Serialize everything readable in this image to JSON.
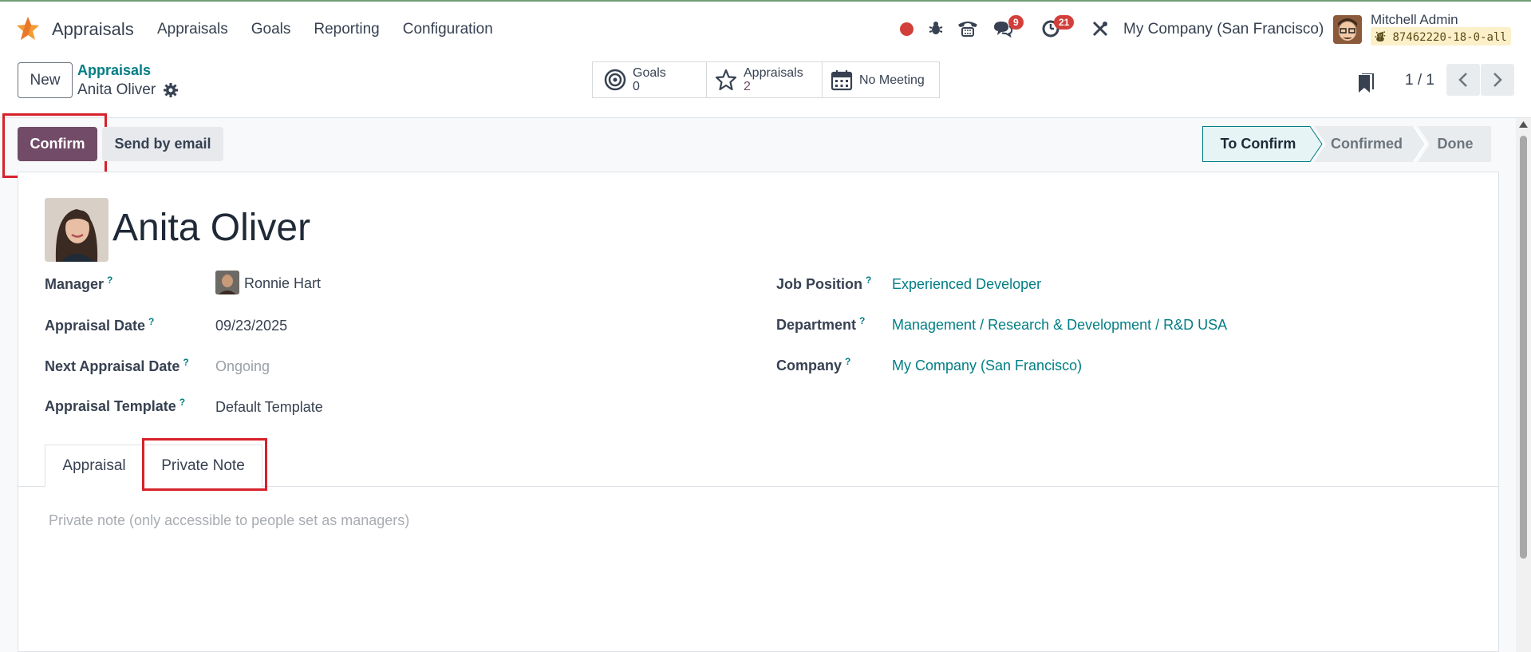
{
  "nav": {
    "app_title": "Appraisals",
    "menu": [
      "Appraisals",
      "Goals",
      "Reporting",
      "Configuration"
    ],
    "messages_badge": "9",
    "activities_badge": "21",
    "company": "My Company (San Francisco)",
    "user_name": "Mitchell Admin",
    "db_name": "87462220-18-0-all"
  },
  "control_panel": {
    "new_label": "New",
    "breadcrumb_parent": "Appraisals",
    "breadcrumb_current": "Anita Oliver",
    "smart_buttons": [
      {
        "label": "Goals",
        "value": "0"
      },
      {
        "label": "Appraisals",
        "value": "2"
      },
      {
        "label": "No Meeting",
        "value": ""
      }
    ],
    "pager": "1 / 1"
  },
  "actions": {
    "confirm_label": "Confirm",
    "send_email_label": "Send by email"
  },
  "statusbar": [
    "To Confirm",
    "Confirmed",
    "Done"
  ],
  "statusbar_active": "To Confirm",
  "employee": {
    "name": "Anita Oliver"
  },
  "fields_left": [
    {
      "label": "Manager",
      "value": "Ronnie Hart"
    },
    {
      "label": "Appraisal Date",
      "value": "09/23/2025"
    },
    {
      "label": "Next Appraisal Date",
      "value": "Ongoing"
    },
    {
      "label": "Appraisal Template",
      "value": "Default Template"
    }
  ],
  "fields_right": [
    {
      "label": "Job Position",
      "value": "Experienced Developer"
    },
    {
      "label": "Department",
      "value": "Management / Research & Development / R&D USA"
    },
    {
      "label": "Company",
      "value": "My Company (San Francisco)"
    }
  ],
  "help_marker": "?",
  "tabs": [
    "Appraisal",
    "Private Note"
  ],
  "active_tab": "Private Note",
  "private_note_placeholder": "Private note (only accessible to people set as managers)",
  "colors": {
    "brand": "#714b67",
    "link": "#017e84",
    "highlight": "#d7212b",
    "badge": "#d23f3a"
  }
}
